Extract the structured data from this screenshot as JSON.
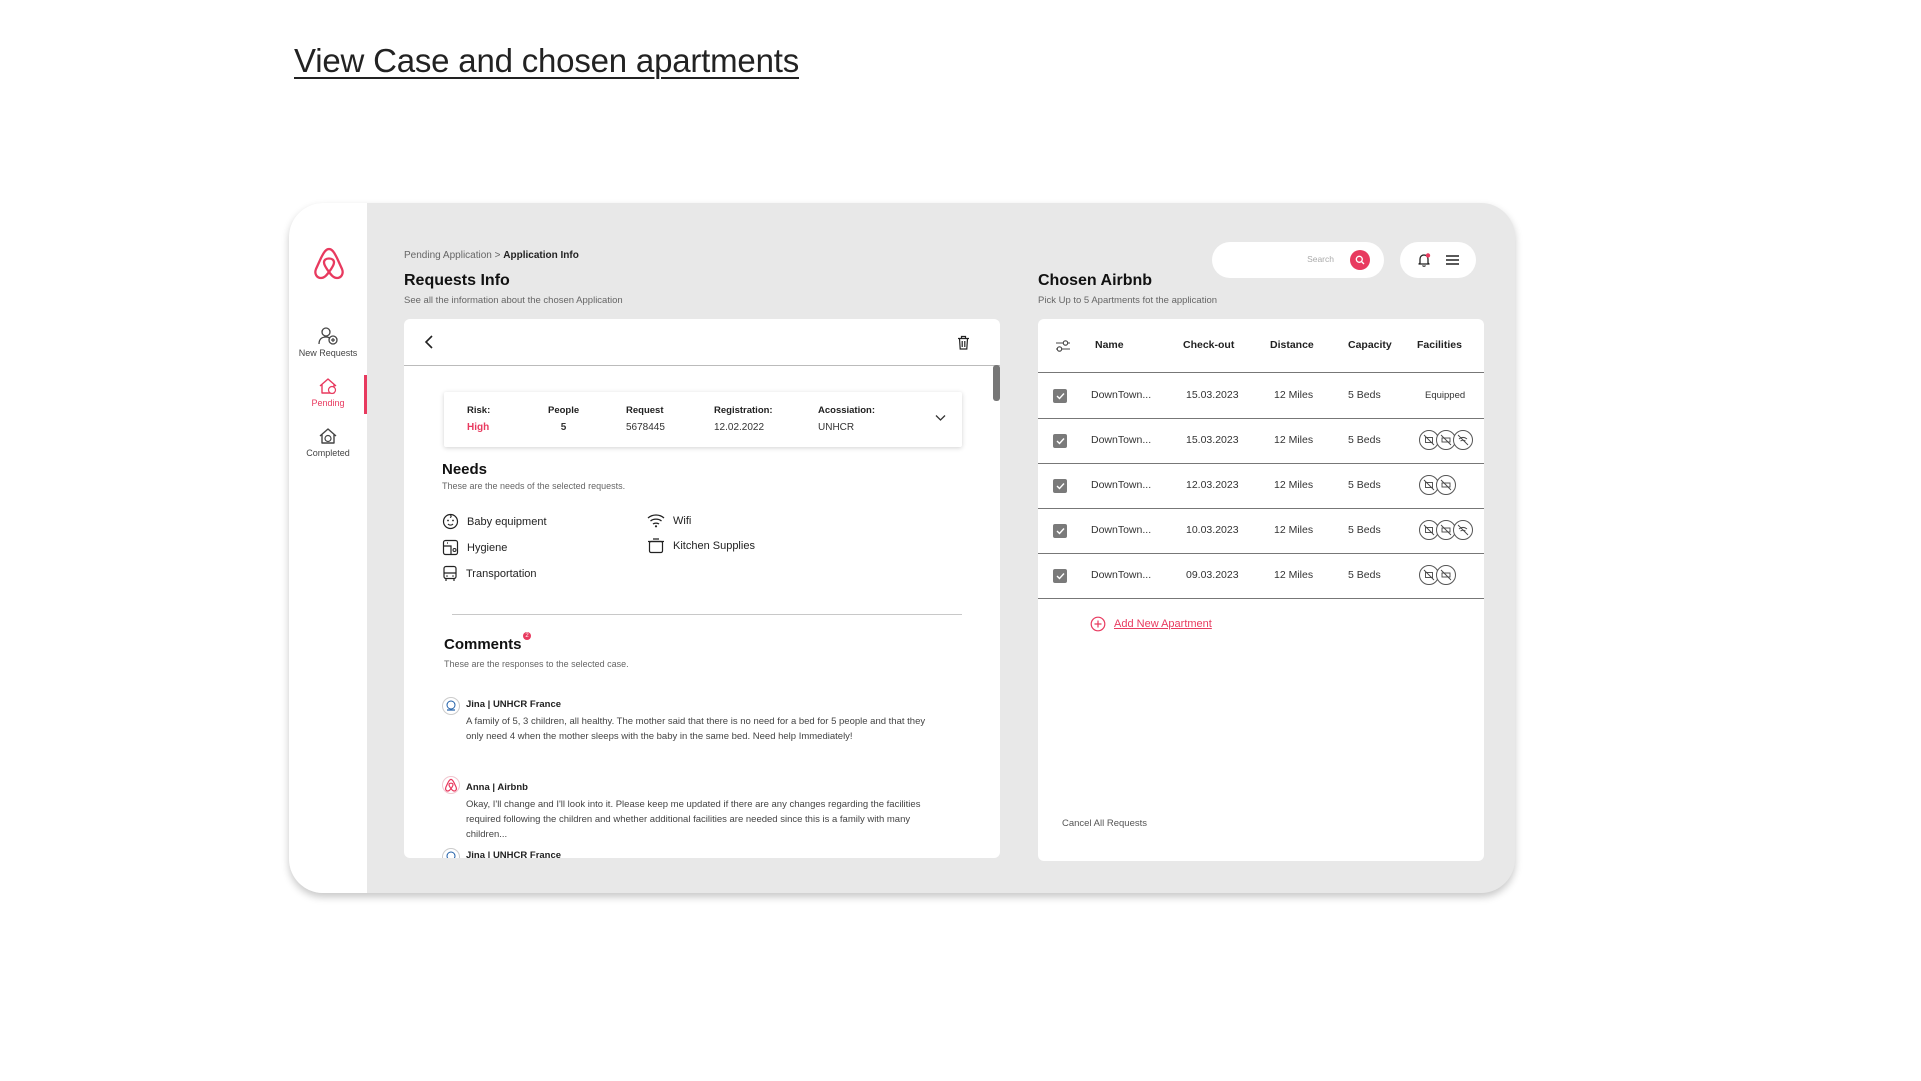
{
  "page_title": "View Case and chosen apartments",
  "sidebar": {
    "items": [
      {
        "label": "New Requests",
        "icon": "user-add-icon"
      },
      {
        "label": "Pending",
        "icon": "home-icon"
      },
      {
        "label": "Completed",
        "icon": "home-check-icon"
      }
    ],
    "active": "Pending"
  },
  "breadcrumb": {
    "parent": "Pending Application",
    "separator": ">",
    "current": "Application Info"
  },
  "search": {
    "placeholder": "Search"
  },
  "requests": {
    "title": "Requests Info",
    "subtitle": "See all the information about the chosen Application",
    "info": {
      "risk_label": "Risk:",
      "risk_value": "High",
      "people_label": "People",
      "people_value": "5",
      "request_label": "Request",
      "request_value": "5678445",
      "registration_label": "Registration:",
      "registration_value": "12.02.2022",
      "association_label": "Acossiation:",
      "association_value": "UNHCR"
    },
    "needs": {
      "title": "Needs",
      "subtitle": "These are the needs of the selected requests.",
      "items": [
        "Baby equipment",
        "Wifi",
        "Hygiene",
        "Kitchen Supplies",
        "Transportation"
      ]
    },
    "comments": {
      "title": "Comments",
      "badge": "2",
      "subtitle": "These are the responses to the selected case.",
      "items": [
        {
          "author": "Jina | UNHCR France",
          "text": "A family of 5, 3 children, all healthy. The mother said that there is no need for a bed for 5 people and that they only need 4 when the mother sleeps with the baby in the same bed. Need help Immediately!"
        },
        {
          "author": "Anna | Airbnb",
          "text": "Okay, I'll change and I'll look into it. Please keep me updated if there are any changes regarding the facilities required following the children and whether additional facilities are needed since this is a family with many children..."
        },
        {
          "author": "Jina | UNHCR France",
          "text": ""
        }
      ]
    }
  },
  "chosen": {
    "title": "Chosen Airbnb",
    "subtitle": "Pick Up to 5 Apartments fot the application",
    "columns": [
      "Name",
      "Check-out",
      "Distance",
      "Capacity",
      "Facilities"
    ],
    "rows": [
      {
        "name": "DownTown...",
        "checkout": "15.03.2023",
        "distance": "12 Miles",
        "capacity": "5 Beds",
        "facilities": "Equipped",
        "icons": 0
      },
      {
        "name": "DownTown...",
        "checkout": "15.03.2023",
        "distance": "12 Miles",
        "capacity": "5 Beds",
        "facilities": "",
        "icons": 3
      },
      {
        "name": "DownTown...",
        "checkout": "12.03.2023",
        "distance": "12 Miles",
        "capacity": "5 Beds",
        "facilities": "",
        "icons": 2
      },
      {
        "name": "DownTown...",
        "checkout": "10.03.2023",
        "distance": "12 Miles",
        "capacity": "5 Beds",
        "facilities": "",
        "icons": 3
      },
      {
        "name": "DownTown...",
        "checkout": "09.03.2023",
        "distance": "12 Miles",
        "capacity": "5 Beds",
        "facilities": "",
        "icons": 2
      }
    ],
    "add_label": "Add New Apartment",
    "cancel_label": "Cancel All Requests"
  },
  "colors": {
    "accent": "#e83a5f",
    "frame": "#e8e8e8"
  }
}
